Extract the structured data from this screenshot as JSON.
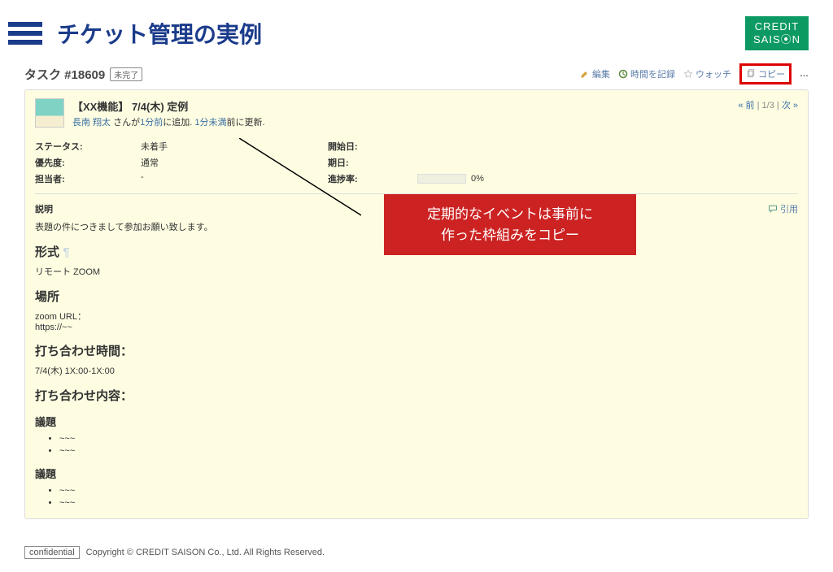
{
  "header": {
    "title": "チケット管理の実例",
    "logo_top": "CREDIT",
    "logo_bottom": "SAIS⦿N"
  },
  "ticket_head": {
    "label": "タスク #18609",
    "status_pill": "未完了"
  },
  "actions": {
    "edit": "編集",
    "log_time": "時間を記録",
    "watch": "ウォッチ",
    "copy": "コピー",
    "more": "…"
  },
  "nav": {
    "prev": "« 前",
    "count": "1/3",
    "next": "次 »"
  },
  "ticket": {
    "title": "【XX機能】 7/4(木) 定例",
    "user": "長南 翔太",
    "meta_1": " さんが",
    "time_1": "1分前",
    "meta_2": "に追加. ",
    "time_2": "1分未満",
    "meta_3": "前に更新."
  },
  "props": {
    "status_label": "ステータス:",
    "status_value": "未着手",
    "priority_label": "優先度:",
    "priority_value": "通常",
    "assignee_label": "担当者:",
    "assignee_value": "-",
    "start_label": "開始日:",
    "start_value": "",
    "due_label": "期日:",
    "due_value": "",
    "progress_label": "進捗率:",
    "progress_value": "0%"
  },
  "desc": {
    "label": "説明",
    "quote": "引用",
    "intro": "表題の件につきまして参加お願い致します。",
    "h_format": "形式",
    "format_text": "リモート ZOOM",
    "h_place": "場所",
    "place_text1": "zoom URL：",
    "place_text2": "https://~~",
    "h_time": "打ち合わせ時間：",
    "time_text": "7/4(木) 1X:00-1X:00",
    "h_content": "打ち合わせ内容：",
    "h_agenda1": "議題",
    "h_agenda2": "議題",
    "bullet": "~~~"
  },
  "callout": {
    "line1": "定期的なイベントは事前に",
    "line2": "作った枠組みをコピー"
  },
  "footer": {
    "confidential": "confidential",
    "copyright": "Copyright © CREDIT SAISON Co., Ltd. All Rights Reserved."
  }
}
